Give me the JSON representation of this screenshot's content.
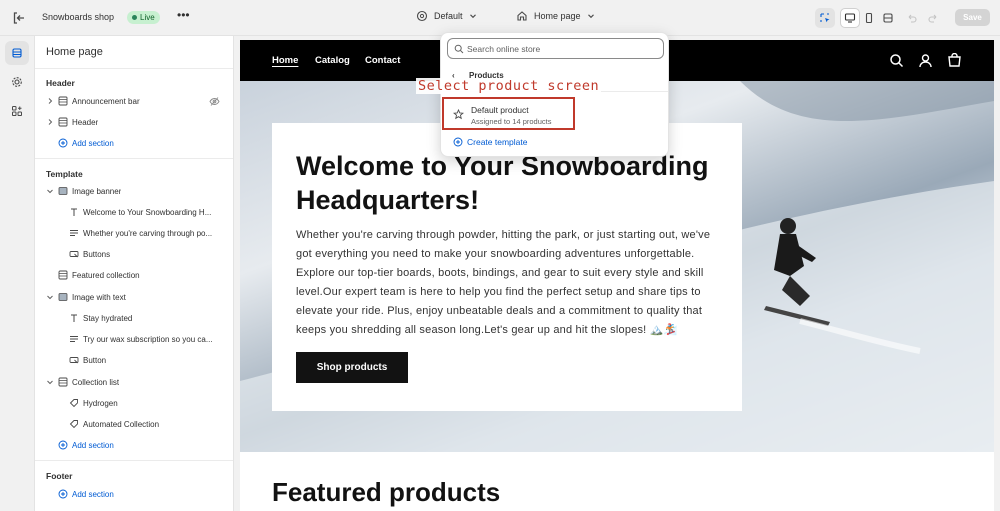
{
  "topbar": {
    "shop_name": "Snowboards shop",
    "live_badge": "Live",
    "theme_selector": "Default",
    "page_selector": "Home page",
    "save_label": "Save"
  },
  "sidebar": {
    "title": "Home page",
    "header_group": "Header",
    "header_items": [
      "Announcement bar",
      "Header"
    ],
    "template_group": "Template",
    "template_items": [
      "Image banner",
      "Welcome to Your Snowboarding H...",
      "Whether you're carving through po...",
      "Buttons",
      "Featured collection",
      "Image with text",
      "Stay hydrated",
      "Try our wax subscription so you ca...",
      "Button",
      "Collection list",
      "Hydrogen",
      "Automated Collection"
    ],
    "footer_group": "Footer",
    "add_section": "Add section"
  },
  "preview": {
    "nav": [
      "Home",
      "Catalog",
      "Contact"
    ],
    "banner_heading": "Welcome to Your Snowboarding Headquarters!",
    "banner_text": "Whether you're carving through powder, hitting the park, or just starting out, we've got everything you need to make your snowboarding adventures unforgettable. Explore our top-tier boards, boots, bindings, and gear to suit every style and skill level.Our expert team is here to help you find the perfect setup and share tips to elevate your ride. Plus, enjoy unbeatable deals and a commitment to quality that keeps you shredding all season long.Let's gear up and hit the slopes! 🏔️🏂",
    "button_label": "Shop products",
    "featured_heading": "Featured products"
  },
  "dropdown": {
    "search_placeholder": "Search online store",
    "back_label": "Products",
    "item_title": "Default product",
    "item_subtitle": "Assigned to 14 products",
    "create_label": "Create template"
  },
  "annotation": "Select product screen",
  "colors": {
    "accent_blue": "#005bd3",
    "highlight_red": "#c0392b",
    "live_green": "#c7f0d0"
  }
}
